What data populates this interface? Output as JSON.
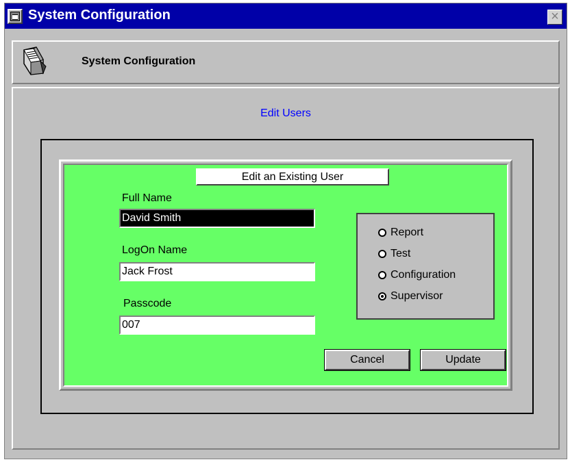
{
  "window": {
    "title": "System Configuration",
    "close_glyph": "×"
  },
  "header": {
    "title": "System Configuration",
    "icon": "document-icon"
  },
  "main": {
    "section_title": "Edit Users",
    "form": {
      "caption": "Edit an Existing User",
      "full_name_label": "Full Name",
      "full_name_value": "David Smith",
      "logon_label": "LogOn Name",
      "logon_value": "Jack Frost",
      "passcode_label": "Passcode",
      "passcode_value": "007"
    },
    "roles": [
      {
        "label": "Report",
        "checked": false
      },
      {
        "label": "Test",
        "checked": false
      },
      {
        "label": "Configuration",
        "checked": false
      },
      {
        "label": "Supervisor",
        "checked": true
      }
    ],
    "buttons": {
      "cancel": "Cancel",
      "update": "Update"
    }
  },
  "colors": {
    "titlebar": "#0000a8",
    "form_background": "#66ff66",
    "section_title": "#0000ff"
  }
}
